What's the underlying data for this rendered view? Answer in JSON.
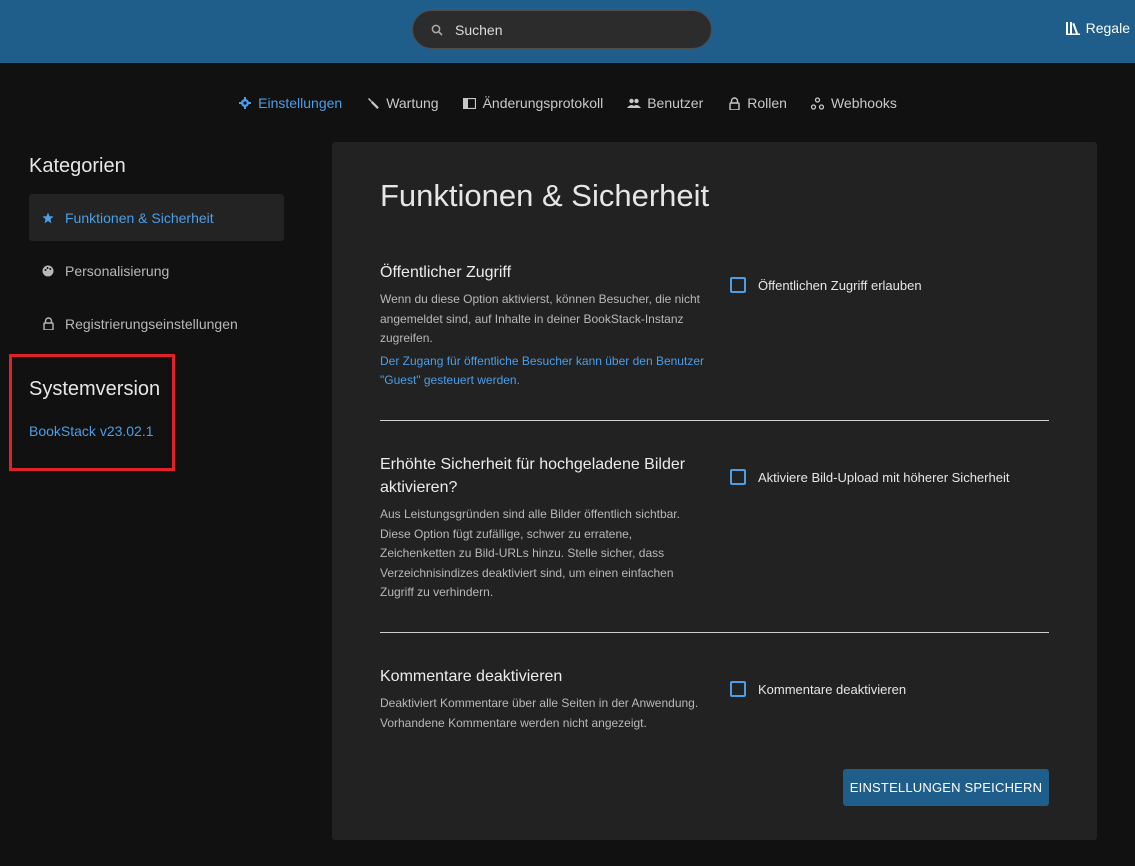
{
  "header": {
    "search_placeholder": "Suchen",
    "shelves_label": "Regale",
    "bg_color": "#1f5d8a"
  },
  "nav": {
    "items": [
      {
        "label": "Einstellungen",
        "icon": "gear-icon",
        "active": true
      },
      {
        "label": "Wartung",
        "icon": "wrench-icon"
      },
      {
        "label": "Änderungsprotokoll",
        "icon": "audit-log-icon"
      },
      {
        "label": "Benutzer",
        "icon": "users-icon"
      },
      {
        "label": "Rollen",
        "icon": "lock-icon"
      },
      {
        "label": "Webhooks",
        "icon": "webhooks-icon"
      }
    ]
  },
  "sidebar": {
    "title": "Kategorien",
    "items": [
      {
        "label": "Funktionen & Sicherheit",
        "icon": "star-icon",
        "active": true
      },
      {
        "label": "Personalisierung",
        "icon": "palette-icon"
      },
      {
        "label": "Registrierungseinstellungen",
        "icon": "lock-icon"
      }
    ],
    "system_title": "Systemversion",
    "system_version": "BookStack v23.02.1"
  },
  "main": {
    "title": "Funktionen & Sicherheit",
    "settings": [
      {
        "title": "Öffentlicher Zugriff",
        "description": "Wenn du diese Option aktivierst, können Besucher, die nicht angemeldet sind, auf Inhalte in deiner BookStack-Instanz zugreifen.",
        "link": "Der Zugang für öffentliche Besucher kann über den Benutzer \"Guest\" gesteuert werden.",
        "checkbox_label": "Öffentlichen Zugriff erlauben",
        "checked": false
      },
      {
        "title": "Erhöhte Sicherheit für hochgeladene Bilder aktivieren?",
        "description": "Aus Leistungsgründen sind alle Bilder öffentlich sichtbar. Diese Option fügt zufällige, schwer zu erratene, Zeichenketten zu Bild-URLs hinzu. Stelle sicher, dass Verzeichnisindizes deaktiviert sind, um einen einfachen Zugriff zu verhindern.",
        "checkbox_label": "Aktiviere Bild-Upload mit höherer Sicherheit",
        "checked": false
      },
      {
        "title": "Kommentare deaktivieren",
        "description": "Deaktiviert Kommentare über alle Seiten in der Anwendung. Vorhandene Kommentare werden nicht angezeigt.",
        "checkbox_label": "Kommentare deaktivieren",
        "checked": false
      }
    ],
    "save_label": "EINSTELLUNGEN SPEICHERN"
  },
  "colors": {
    "accent": "#4b9ee8",
    "highlight_box": "#e0222a"
  }
}
